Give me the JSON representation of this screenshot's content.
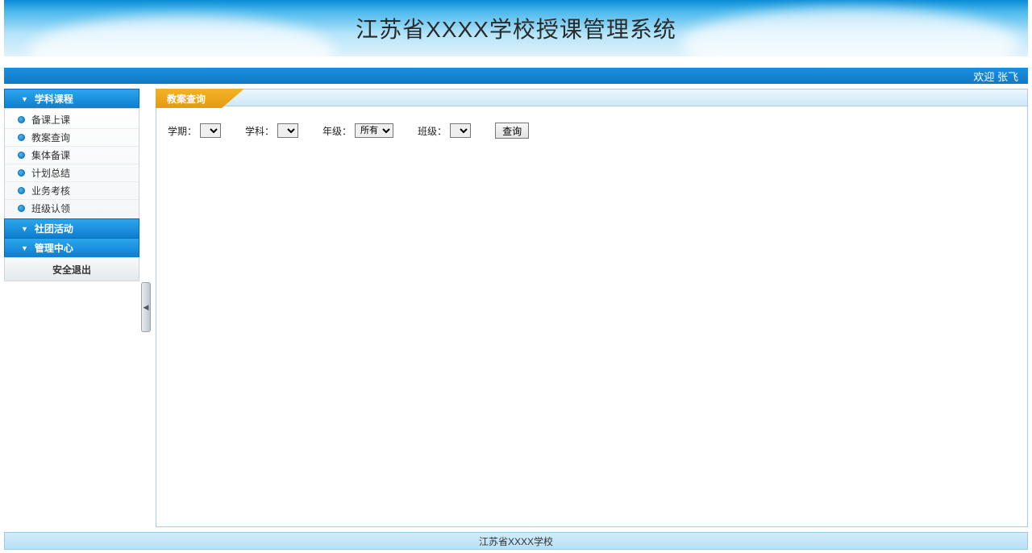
{
  "header": {
    "title": "江苏省XXXX学校授课管理系统"
  },
  "welcome": {
    "prefix": "欢迎",
    "user": "张飞"
  },
  "sidebar": {
    "sections": [
      {
        "title": "学科课程",
        "items": [
          "备课上课",
          "教案查询",
          "集体备课",
          "计划总结",
          "业务考核",
          "班级认领"
        ]
      },
      {
        "title": "社团活动",
        "items": []
      },
      {
        "title": "管理中心",
        "items": []
      }
    ],
    "logout_label": "安全退出"
  },
  "content": {
    "tab_title": "教案查询",
    "filters": {
      "semester_label": "学期：",
      "subject_label": "学科：",
      "grade_label": "年级：",
      "grade_selected": "所有",
      "class_label": "班级：",
      "query_button": "查询"
    }
  },
  "footer": {
    "text": "江苏省XXXX学校"
  }
}
